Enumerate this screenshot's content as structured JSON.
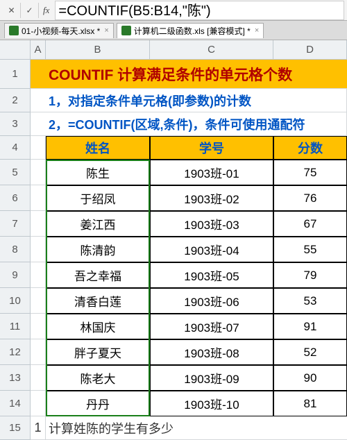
{
  "formula_bar": {
    "cancel": "✕",
    "confirm": "✓",
    "fx": "fx",
    "formula": "=COUNTIF(B5:B14,\"陈\")"
  },
  "tabs": [
    {
      "label": "01-小视频-每天.xlsx *",
      "active": false
    },
    {
      "label": "计算机二级函数.xls  [兼容模式] *",
      "active": true
    }
  ],
  "columns": [
    "A",
    "B",
    "C",
    "D"
  ],
  "title": "COUNTIF 计算满足条件的单元格个数",
  "sub1": "1，对指定条件单元格(即参数)的计数",
  "sub2": "2，=COUNTIF(区域,条件)，条件可使用通配符",
  "headers": {
    "name": "姓名",
    "id": "学号",
    "score": "分数"
  },
  "rows": [
    {
      "n": 5,
      "name": "陈生",
      "id": "1903班-01",
      "score": "75"
    },
    {
      "n": 6,
      "name": "于绍凤",
      "id": "1903班-02",
      "score": "76"
    },
    {
      "n": 7,
      "name": "姜江西",
      "id": "1903班-03",
      "score": "67"
    },
    {
      "n": 8,
      "name": "陈清韵",
      "id": "1903班-04",
      "score": "55"
    },
    {
      "n": 9,
      "name": "吾之幸福",
      "id": "1903班-05",
      "score": "79"
    },
    {
      "n": 10,
      "name": "清香白莲",
      "id": "1903班-06",
      "score": "53"
    },
    {
      "n": 11,
      "name": "林国庆",
      "id": "1903班-07",
      "score": "91"
    },
    {
      "n": 12,
      "name": "胖子夏天",
      "id": "1903班-08",
      "score": "52"
    },
    {
      "n": 13,
      "name": "陈老大",
      "id": "1903班-09",
      "score": "90"
    },
    {
      "n": 14,
      "name": "丹丹",
      "id": "1903班-10",
      "score": "81"
    }
  ],
  "bottom": {
    "n": 15,
    "a": "1",
    "text": "计算姓陈的学生有多少"
  }
}
